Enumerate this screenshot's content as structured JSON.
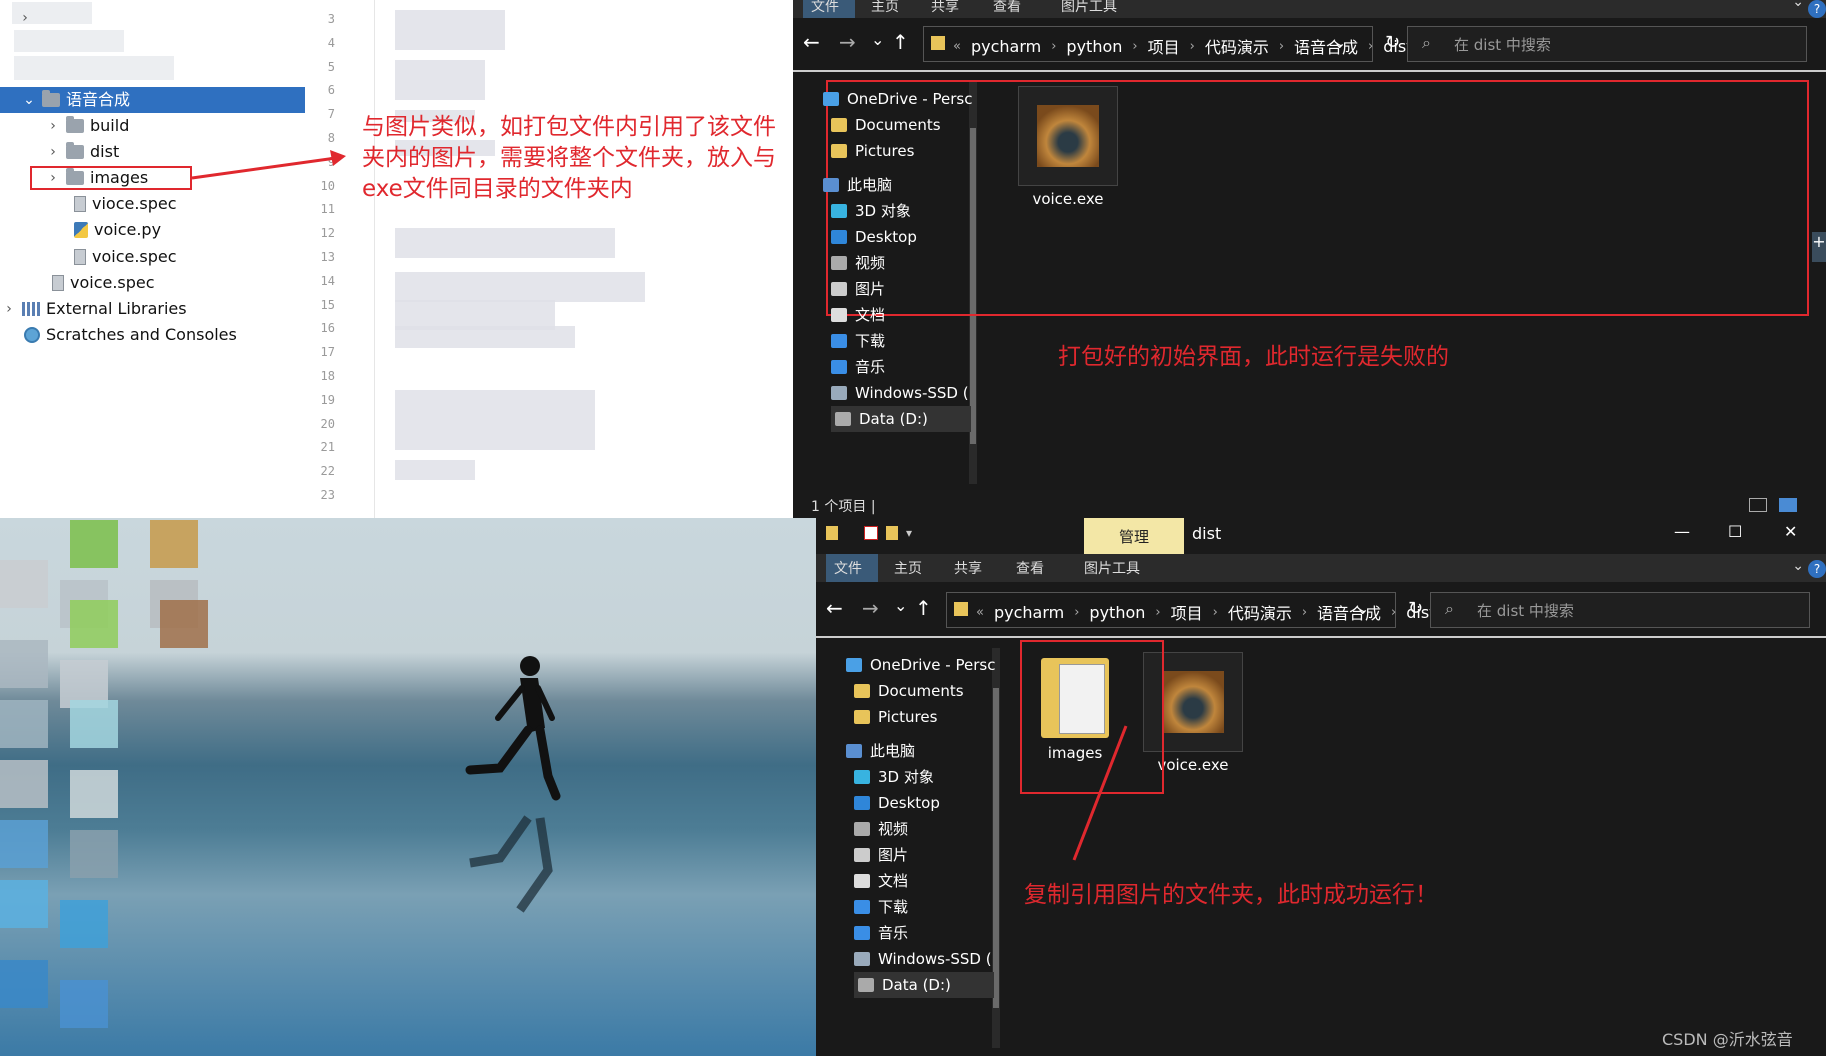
{
  "ide_tree": {
    "root_folder": "语音合成",
    "items": [
      "build",
      "dist",
      "images",
      "vioce.spec",
      "voice.py",
      "voice.spec"
    ],
    "parent_file": "voice.spec",
    "external_libraries": "External Libraries",
    "scratches": "Scratches and Consoles"
  },
  "editor": {
    "line_numbers": [
      "3",
      "4",
      "5",
      "6",
      "7",
      "8",
      "9",
      "10",
      "11",
      "12",
      "13",
      "14",
      "15",
      "16",
      "17",
      "18",
      "19",
      "20",
      "21",
      "22",
      "23"
    ]
  },
  "annotations": {
    "ide_note": "与图片类似，如打包文件内引用了该文件夹内的图片，需要将整个文件夹，放入与exe文件同目录的文件夹内",
    "ide_note_lines": [
      "与图片类似，如打包文件内引用了该文件",
      "夹内的图片，需要将整个文件夹，放入与",
      "exe文件同目录的文件夹内"
    ],
    "top_note": "打包好的初始界面，此时运行是失败的",
    "bottom_note": "复制引用图片的文件夹，此时成功运行！"
  },
  "explorer_top": {
    "ribbon_tabs": [
      "文件",
      "主页",
      "共享",
      "查看",
      "图片工具"
    ],
    "breadcrumb": [
      "pycharm",
      "python",
      "项目",
      "代码演示",
      "语音合成",
      "dist"
    ],
    "search_placeholder": "在 dist 中搜索",
    "nav": [
      "OneDrive - Persc",
      "Documents",
      "Pictures",
      "此电脑",
      "3D 对象",
      "Desktop",
      "视频",
      "图片",
      "文档",
      "下载",
      "音乐",
      "Windows-SSD (",
      "Data (D:)"
    ],
    "files": [
      "voice.exe"
    ],
    "status": "1 个项目",
    "status_sep": "|"
  },
  "explorer_bottom": {
    "title": "dist",
    "manage_tab": "管理",
    "ribbon_tabs": [
      "文件",
      "主页",
      "共享",
      "查看",
      "图片工具"
    ],
    "breadcrumb": [
      "pycharm",
      "python",
      "项目",
      "代码演示",
      "语音合成",
      "dist"
    ],
    "search_placeholder": "在 dist 中搜索",
    "nav": [
      "OneDrive - Persc",
      "Documents",
      "Pictures",
      "此电脑",
      "3D 对象",
      "Desktop",
      "视频",
      "图片",
      "文档",
      "下载",
      "音乐",
      "Windows-SSD (",
      "Data (D:)"
    ],
    "files": [
      "images",
      "voice.exe"
    ],
    "window_controls": [
      "—",
      "☐",
      "✕"
    ]
  },
  "watermark": "CSDN @沂水弦音",
  "colors": {
    "accent_red": "#e0282e",
    "selection_blue": "#2f70c0",
    "explorer_bg": "#191919",
    "manage_tab": "#f3e7a6"
  }
}
